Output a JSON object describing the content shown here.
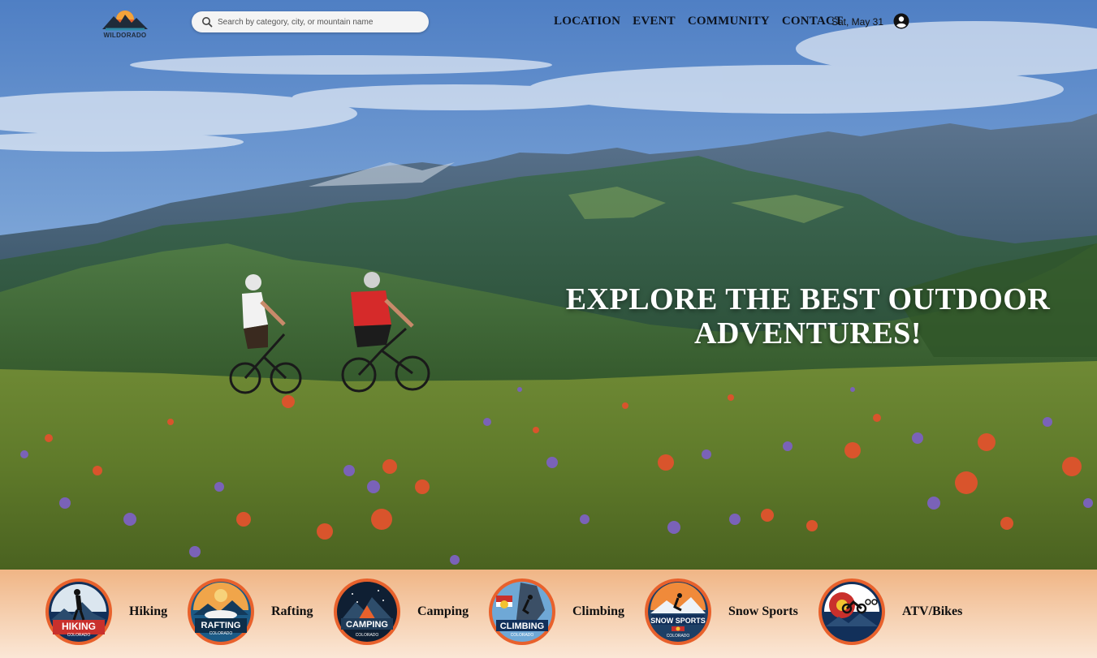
{
  "brand": {
    "name": "WILDORADO"
  },
  "search": {
    "placeholder": "Search by category, city, or mountain name",
    "value": ""
  },
  "nav": {
    "items": [
      {
        "label": "LOCATION"
      },
      {
        "label": "EVENT"
      },
      {
        "label": "COMMUNITY"
      },
      {
        "label": "CONTACT"
      }
    ],
    "date": "Sat, May 31"
  },
  "hero": {
    "headline_line1": "EXPLORE THE BEST OUTDOOR",
    "headline_line2": "ADVENTURES!"
  },
  "categories": [
    {
      "label": "Hiking",
      "badge_title": "HIKING",
      "badge_sub": "COLORADO",
      "icon": "hiker-icon"
    },
    {
      "label": "Rafting",
      "badge_title": "RAFTING",
      "badge_sub": "COLORADO",
      "icon": "raft-icon"
    },
    {
      "label": "Camping",
      "badge_title": "CAMPING",
      "badge_sub": "COLORADO",
      "icon": "tent-icon"
    },
    {
      "label": "Climbing",
      "badge_title": "CLIMBING",
      "badge_sub": "COLORADO",
      "icon": "climber-icon"
    },
    {
      "label": "Snow Sports",
      "badge_title": "SNOW SPORTS",
      "badge_sub": "COLORADO",
      "icon": "skier-icon"
    },
    {
      "label": "ATV/Bikes",
      "badge_title": "",
      "badge_sub": "",
      "icon": "atv-icon"
    }
  ],
  "colors": {
    "accent": "#e87b3a",
    "category_bar": "#f3c4a0",
    "text_dark": "#0d1420"
  }
}
